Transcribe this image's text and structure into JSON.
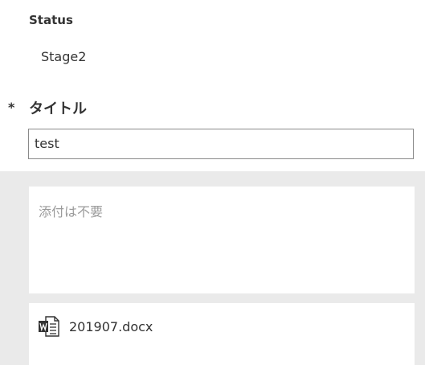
{
  "status": {
    "label": "Status",
    "value": "Stage2"
  },
  "title_field": {
    "required_marker": "*",
    "label": "タイトル",
    "value": "test"
  },
  "attachments": {
    "note_placeholder": "添付は不要",
    "file": {
      "name": "201907.docx",
      "icon": "word-document-icon"
    }
  }
}
